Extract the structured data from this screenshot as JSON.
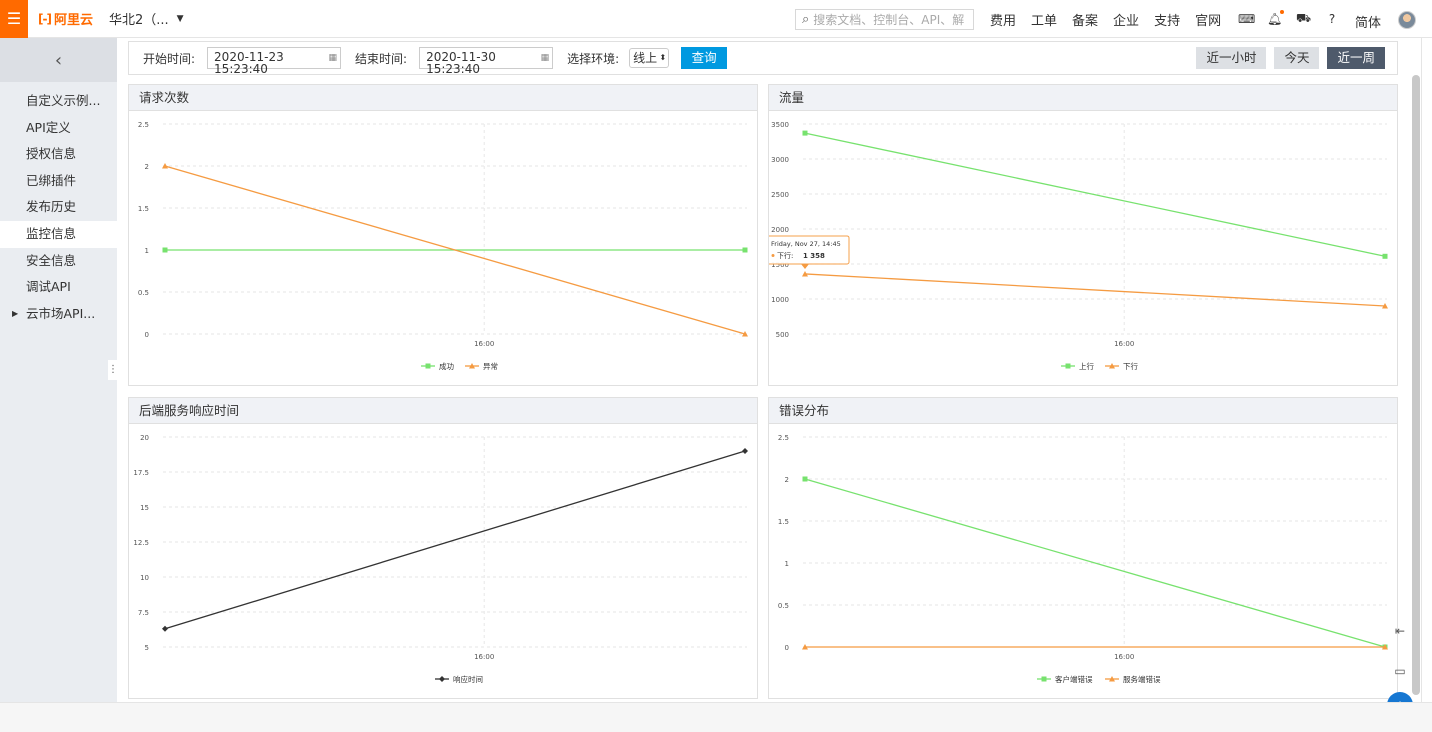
{
  "topbar": {
    "brand": "阿里云",
    "region": "华北2（...",
    "search_placeholder": "搜索文档、控制台、API、解",
    "links": [
      "费用",
      "工单",
      "备案",
      "企业",
      "支持",
      "官网"
    ],
    "lang": "简体"
  },
  "sidebar": {
    "items": [
      {
        "label": "自定义示例..."
      },
      {
        "label": "API定义"
      },
      {
        "label": "授权信息"
      },
      {
        "label": "已绑插件"
      },
      {
        "label": "发布历史"
      },
      {
        "label": "监控信息",
        "active": true
      },
      {
        "label": "安全信息"
      },
      {
        "label": "调试API"
      },
      {
        "label": "云市场API..."
      }
    ]
  },
  "filter": {
    "start_label": "开始时间:",
    "start_value": "2020-11-23 15:23:40",
    "end_label": "结束时间:",
    "end_value": "2020-11-30 15:23:40",
    "env_label": "选择环境:",
    "env_value": "线上",
    "query_button": "查询",
    "ranges": [
      "近一小时",
      "今天",
      "近一周"
    ],
    "active_range": "近一周"
  },
  "colors": {
    "green": "#77e26e",
    "orange": "#f59b42",
    "dark": "#333333",
    "accent": "#0099e0"
  },
  "chart_data": [
    {
      "title": "请求次数",
      "type": "line",
      "x": [
        "Nov 23",
        "Nov 30"
      ],
      "xtick": "16:00",
      "ylim": [
        0,
        2.5
      ],
      "yticks": [
        "0",
        "0.5",
        "1",
        "1.5",
        "2",
        "2.5"
      ],
      "series": [
        {
          "name": "成功",
          "values": [
            1,
            1
          ],
          "color": "#77e26e",
          "marker": "square"
        },
        {
          "name": "异常",
          "values": [
            2,
            0
          ],
          "color": "#f59b42",
          "marker": "triangle"
        }
      ]
    },
    {
      "title": "流量",
      "type": "line",
      "x": [
        "Nov 23",
        "Nov 30"
      ],
      "xtick": "16:00",
      "ylim": [
        500,
        3500
      ],
      "yticks": [
        "500",
        "1000",
        "1500",
        "2000",
        "2500",
        "3000",
        "3500"
      ],
      "series": [
        {
          "name": "上行",
          "values": [
            3370,
            1610
          ],
          "color": "#77e26e",
          "marker": "square"
        },
        {
          "name": "下行",
          "values": [
            1358,
            900
          ],
          "color": "#f59b42",
          "marker": "triangle"
        }
      ],
      "tooltip": {
        "date": "Friday, Nov 27, 14:45",
        "series": "下行:",
        "value": "1 358"
      }
    },
    {
      "title": "后端服务响应时间",
      "type": "line",
      "x": [
        "Nov 23",
        "Nov 30"
      ],
      "xtick": "16:00",
      "ylim": [
        5,
        20
      ],
      "yticks": [
        "5",
        "7.5",
        "10",
        "12.5",
        "15",
        "17.5",
        "20"
      ],
      "series": [
        {
          "name": "响应时间",
          "values": [
            6.3,
            19
          ],
          "color": "#333333",
          "marker": "diamond"
        }
      ]
    },
    {
      "title": "错误分布",
      "type": "line",
      "x": [
        "Nov 23",
        "Nov 30"
      ],
      "xtick": "16:00",
      "ylim": [
        0,
        2.5
      ],
      "yticks": [
        "0",
        "0.5",
        "1",
        "1.5",
        "2",
        "2.5"
      ],
      "series": [
        {
          "name": "客户端错误",
          "values": [
            2,
            0
          ],
          "color": "#77e26e",
          "marker": "square"
        },
        {
          "name": "服务端错误",
          "values": [
            0,
            0
          ],
          "color": "#f59b42",
          "marker": "triangle"
        }
      ]
    }
  ]
}
